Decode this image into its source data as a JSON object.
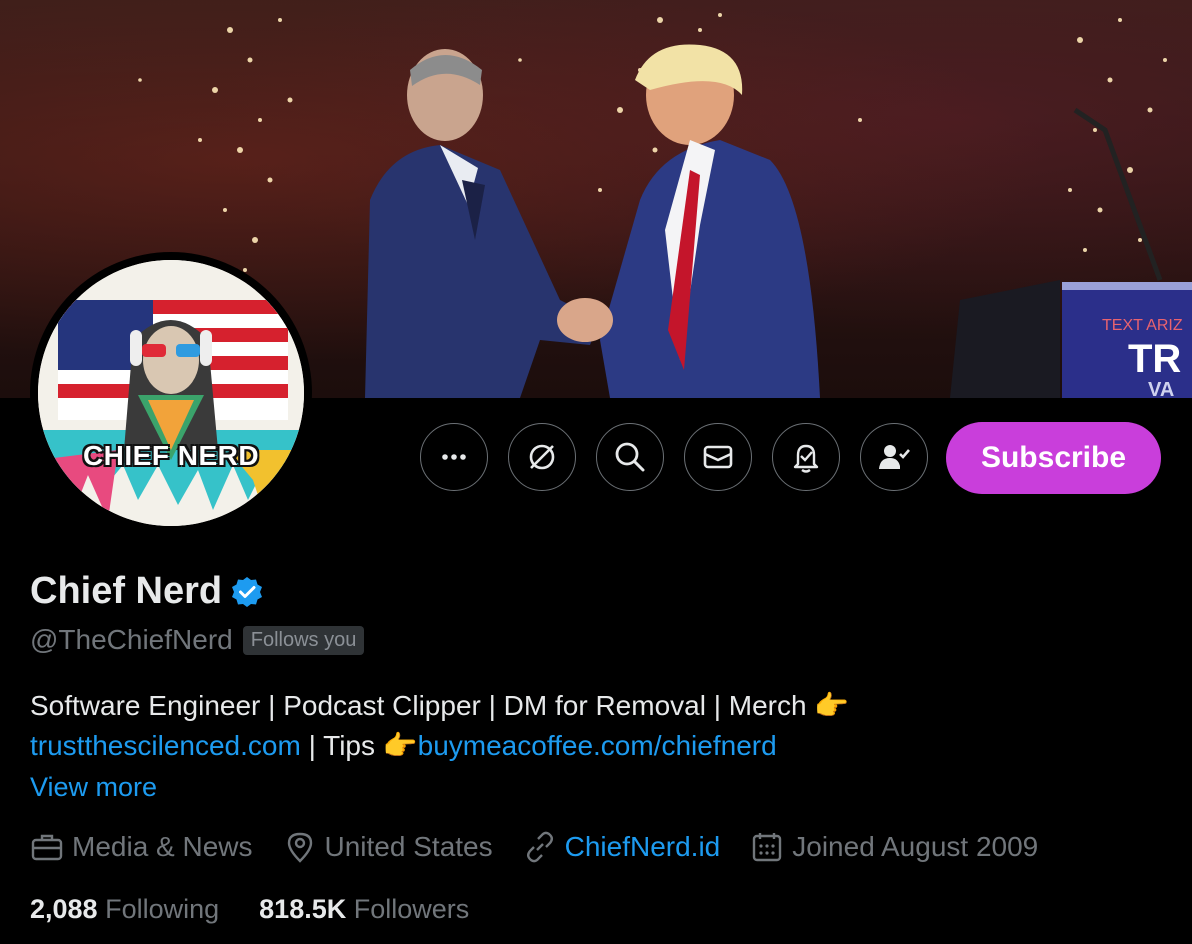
{
  "banner": {
    "sign_text": "TEXT ARIZ",
    "sign_big": "TR",
    "sign_small": "VA"
  },
  "avatar": {
    "text": "CHIEF NERD"
  },
  "actions": {
    "more_icon": "more-icon",
    "grok_icon": "grok-icon",
    "search_icon": "search-icon",
    "message_icon": "mail-icon",
    "notify_icon": "bell-check-icon",
    "following_icon": "person-check-icon",
    "subscribe_label": "Subscribe"
  },
  "profile": {
    "name": "Chief Nerd",
    "handle": "@TheChiefNerd",
    "follows_you": "Follows you",
    "bio_line1": "Software Engineer | Podcast Clipper |  DM for Removal | Merch ",
    "bio_emoji": "👉",
    "bio_link1": "trustthescilenced.com",
    "bio_mid": " | Tips ",
    "bio_link2": "buymeacoffee.com/chiefnerd",
    "view_more": "View more"
  },
  "meta": {
    "category": "Media & News",
    "location": "United States",
    "website": "ChiefNerd.id",
    "joined": "Joined August 2009"
  },
  "stats": {
    "following_count": "2,088",
    "following_label": "Following",
    "followers_count": "818.5K",
    "followers_label": "Followers"
  },
  "colors": {
    "accent_blue": "#1d9bf0",
    "subscribe_purple": "#c93edb",
    "muted": "#71767b"
  }
}
